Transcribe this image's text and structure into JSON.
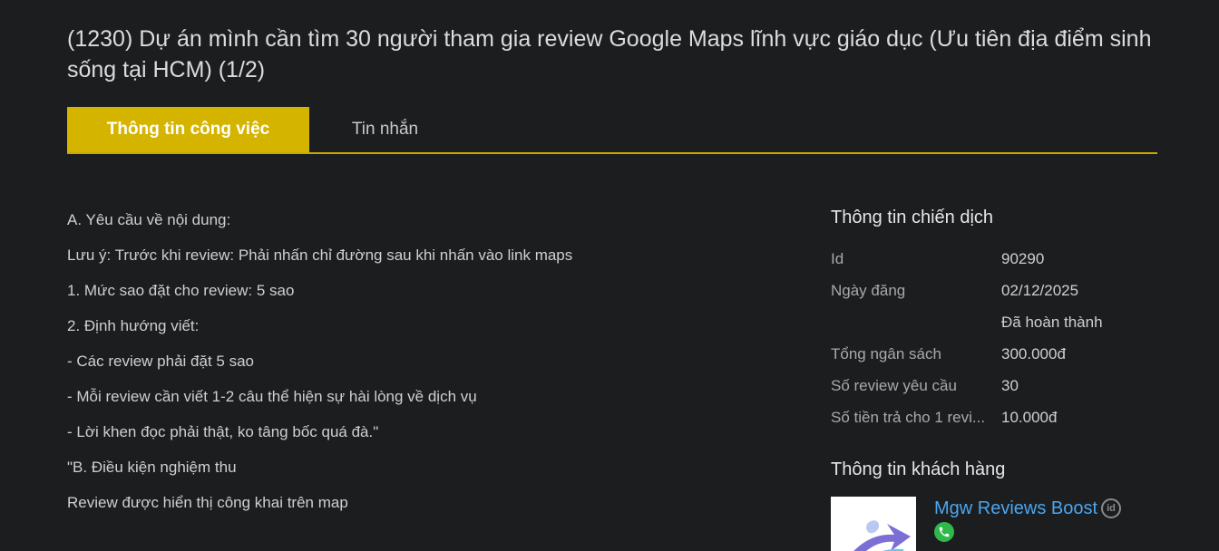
{
  "job": {
    "title": "(1230) Dự án mình cần tìm 30 người tham gia review Google Maps lĩnh vực giáo dục (Ưu tiên địa điểm sinh sống tại HCM) (1/2)"
  },
  "tabs": {
    "active_label": "Thông tin công việc",
    "inactive_label": "Tin nhắn"
  },
  "content": {
    "lines": [
      "A. Yêu cầu về nội dung:",
      "Lưu ý: Trước khi review: Phải nhấn chỉ đường sau khi nhấn vào link maps",
      "1. Mức sao đặt cho review: 5 sao",
      "2. Định hướng viết:",
      "- Các review phải đặt 5 sao",
      "- Mỗi review cần viết 1-2 câu thể hiện sự hài lòng về dịch vụ",
      "- Lời khen đọc phải thật, ko tâng bốc quá đà.\"",
      "\"B. Điều kiện nghiệm thu",
      "Review được hiển thị công khai trên map"
    ]
  },
  "campaign": {
    "heading": "Thông tin chiến dịch",
    "rows": [
      {
        "label": "Id",
        "value": "90290"
      },
      {
        "label": "Ngày đăng",
        "value": "02/12/2025"
      },
      {
        "label": "",
        "value": "Đã hoàn thành"
      },
      {
        "label": "Tổng ngân sách",
        "value": "300.000đ"
      },
      {
        "label": "Số review yêu cầu",
        "value": "30"
      },
      {
        "label": "Số tiền trả cho 1 revi...",
        "value": "10.000đ"
      }
    ]
  },
  "customer": {
    "heading": "Thông tin khách hàng",
    "name": "Mgw Reviews Boost",
    "id_badge": "id"
  },
  "colors": {
    "background": "#1c1d1f",
    "accent": "#d5b400",
    "link": "#4aa6f0",
    "phone": "#2fb94b"
  }
}
